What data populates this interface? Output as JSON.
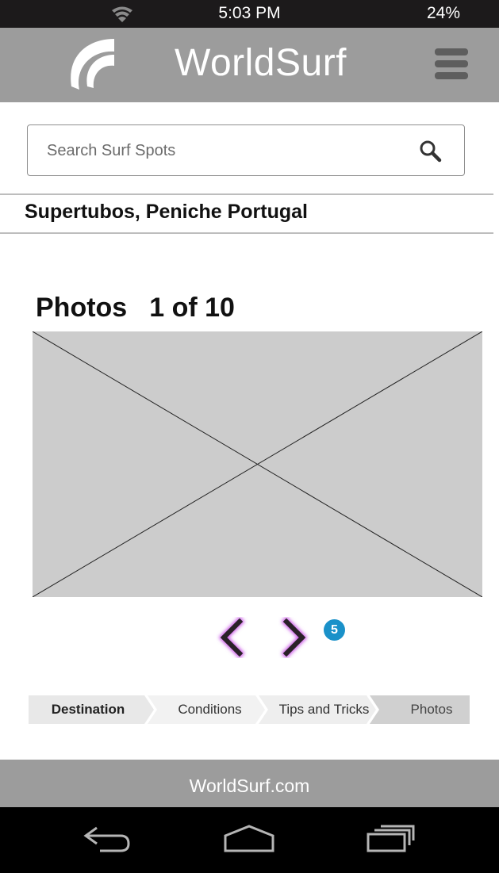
{
  "status_bar": {
    "time": "5:03 PM",
    "battery": "24%",
    "wifi_icon": "wifi-icon"
  },
  "header": {
    "title": "WorldSurf",
    "logo_icon": "wave-logo-icon",
    "menu_icon": "hamburger-menu-icon"
  },
  "search": {
    "placeholder": "Search Surf Spots",
    "value": "",
    "icon": "search-icon"
  },
  "location": {
    "title": "Supertubos, Peniche Portugal"
  },
  "photos": {
    "label": "Photos",
    "counter": "1 of 10",
    "current": 1,
    "total": 10
  },
  "pager": {
    "prev_icon": "chevron-left-icon",
    "next_icon": "chevron-right-icon",
    "badge": "5"
  },
  "breadcrumb": {
    "items": [
      {
        "label": "Destination"
      },
      {
        "label": "Conditions"
      },
      {
        "label": "Tips and Tricks"
      },
      {
        "label": "Photos"
      }
    ]
  },
  "footer": {
    "text": "WorldSurf.com"
  },
  "nav_bar": {
    "back_icon": "back-icon",
    "home_icon": "home-icon",
    "recents_icon": "recent-apps-icon"
  },
  "colors": {
    "header_bg": "#9c9c9c",
    "status_bg": "#1c1a1b",
    "badge": "#1a91c9",
    "placeholder_bg": "#cccccc",
    "arrow_glow": "#c84fe6"
  }
}
